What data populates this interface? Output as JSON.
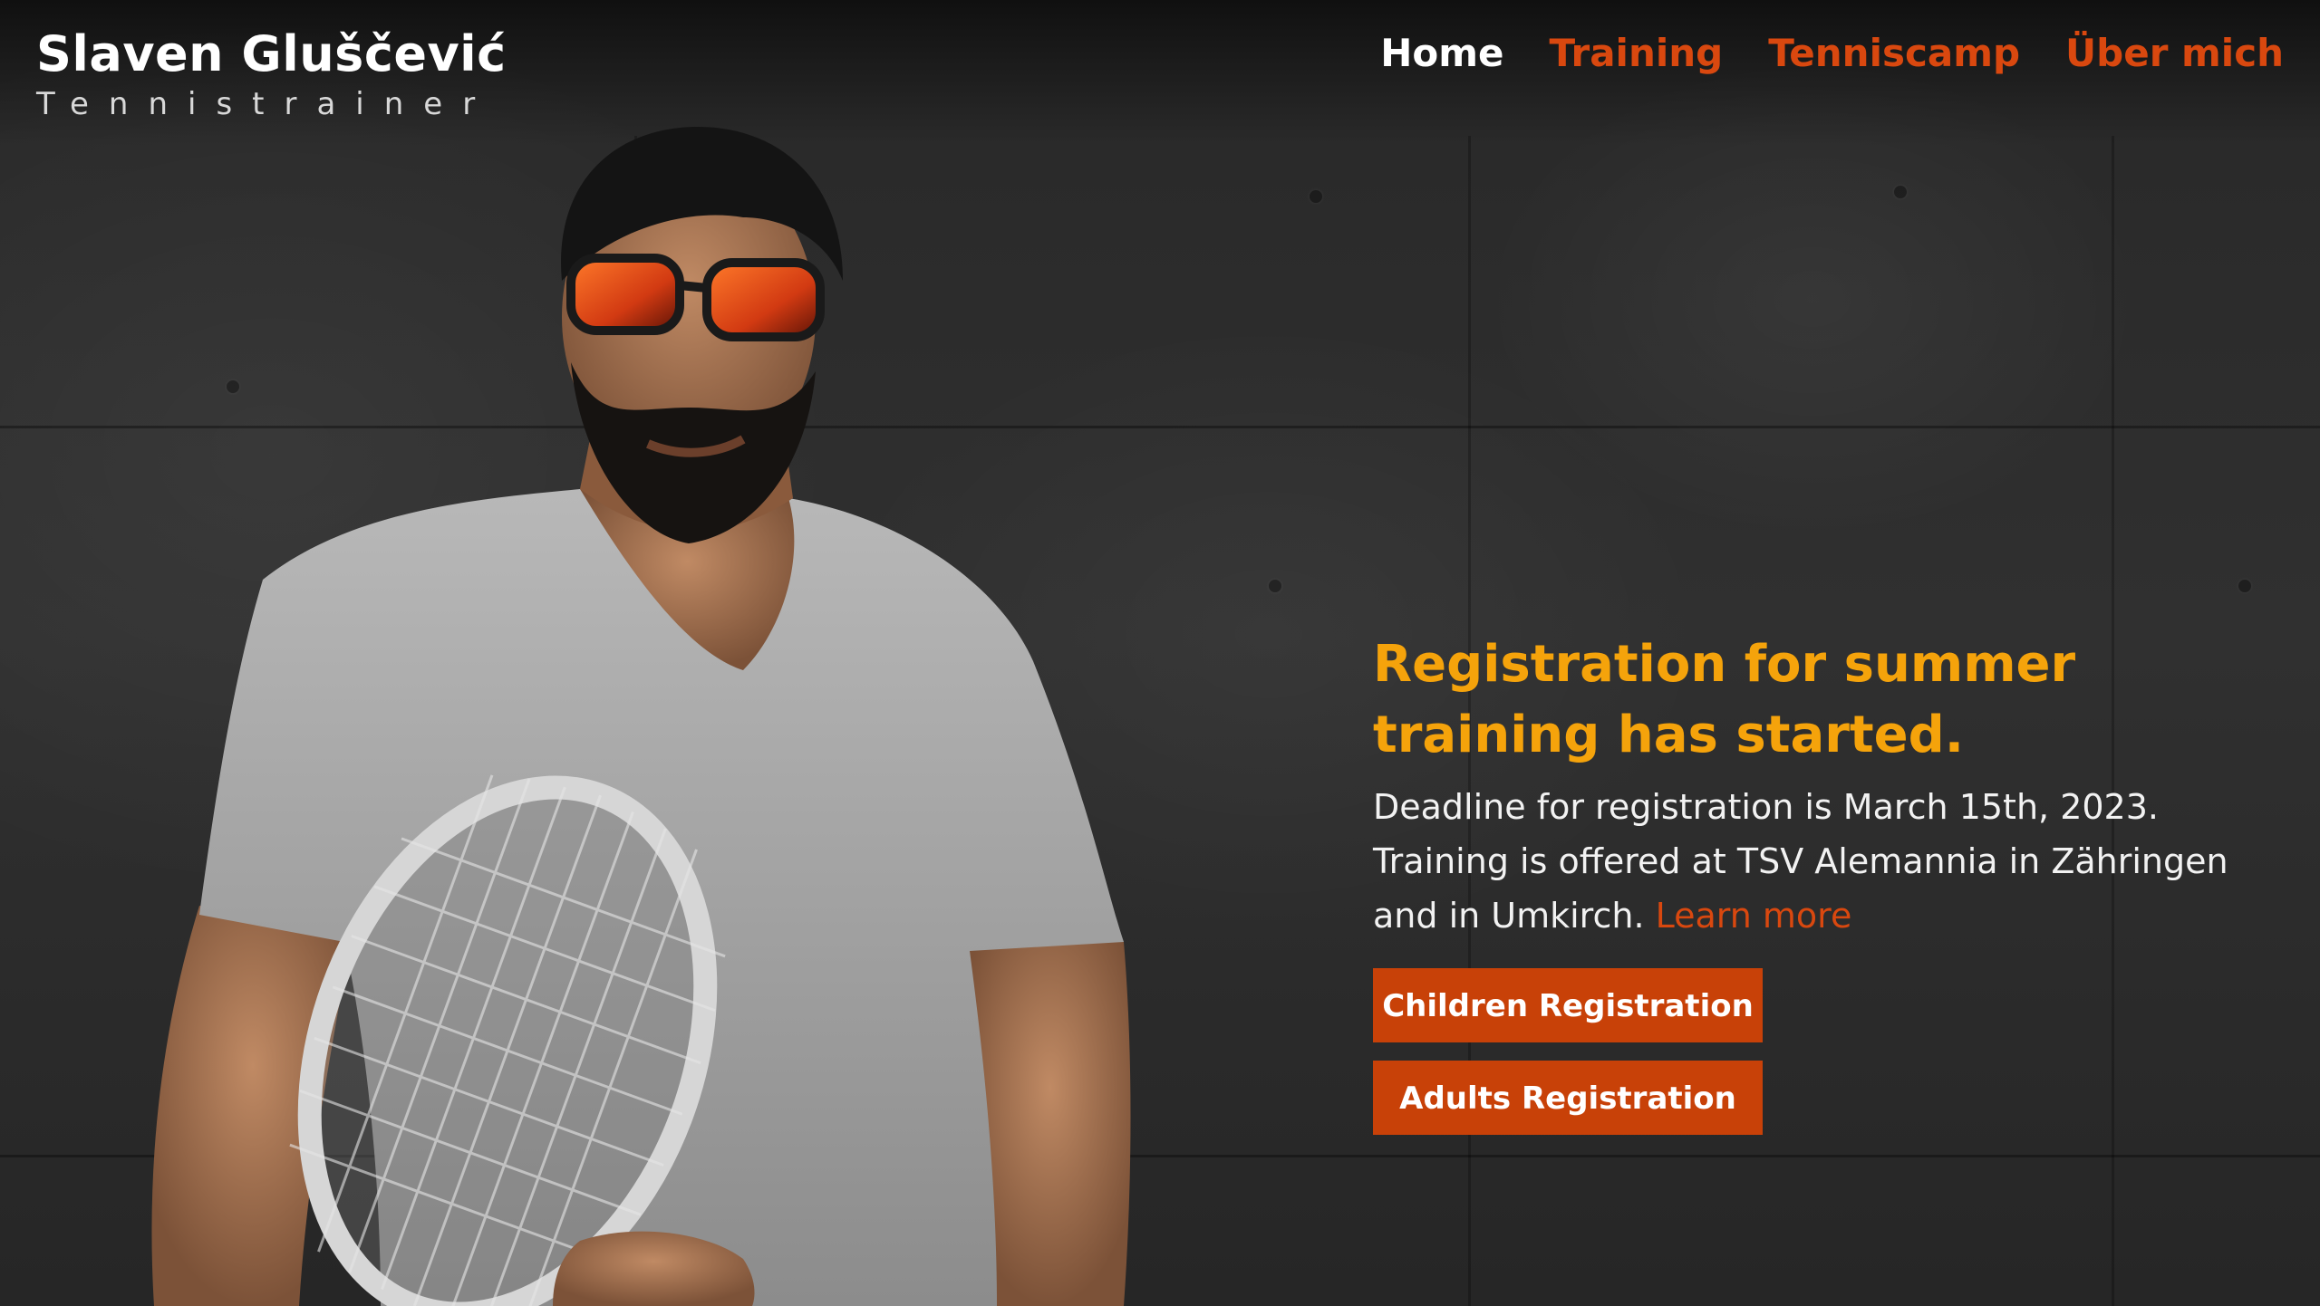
{
  "brand": {
    "name": "Slaven Gluščević",
    "tagline": "Tennistrainer"
  },
  "nav": {
    "items": [
      {
        "label": "Home",
        "active": true
      },
      {
        "label": "Training",
        "active": false
      },
      {
        "label": "Tenniscamp",
        "active": false
      },
      {
        "label": "Über mich",
        "active": false
      }
    ]
  },
  "announcement": {
    "title": "Registration for summer training has started.",
    "body_1": "Deadline for registration is March 15th, 2023. Training is offered at TSV Alemannia in Zähringen and in Umkirch.",
    "learn_more": "Learn more"
  },
  "buttons": {
    "children": "Children Registration",
    "adults": "Adults Registration"
  },
  "colors": {
    "accent_orange": "#d9480f",
    "title_yellow": "#f5a30b",
    "button_bg": "#c84108",
    "text_white": "#ffffff"
  }
}
